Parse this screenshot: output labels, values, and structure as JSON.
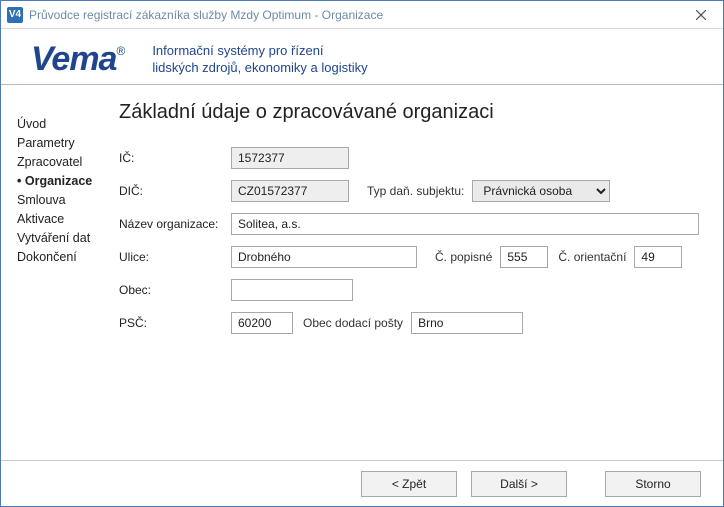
{
  "window": {
    "title": "Průvodce registrací zákazníka služby Mzdy Optimum - Organizace",
    "app_icon_text": "V4"
  },
  "header": {
    "logo_text": "Vema",
    "logo_reg": "®",
    "tagline_line1": "Informační systémy pro řízení",
    "tagline_line2": "lidských zdrojů, ekonomiky a logistiky"
  },
  "sidebar": {
    "steps": [
      {
        "label": "Úvod",
        "current": false
      },
      {
        "label": "Parametry",
        "current": false
      },
      {
        "label": "Zpracovatel",
        "current": false
      },
      {
        "label": "Organizace",
        "current": true
      },
      {
        "label": "Smlouva",
        "current": false
      },
      {
        "label": "Aktivace",
        "current": false
      },
      {
        "label": "Vytváření dat",
        "current": false
      },
      {
        "label": "Dokončení",
        "current": false
      }
    ]
  },
  "main": {
    "heading": "Základní údaje o zpracovávané organizaci",
    "labels": {
      "ic": "IČ:",
      "dic": "DIČ:",
      "subject_type": "Typ daň. subjektu:",
      "org_name": "Název organizace:",
      "street": "Ulice:",
      "house_no": "Č. popisné",
      "orient_no": "Č. orientační",
      "city": "Obec:",
      "psc": "PSČ:",
      "post_city": "Obec dodací pošty"
    },
    "values": {
      "ic": "1572377",
      "dic": "CZ01572377",
      "subject_type_selected": "Právnická osoba",
      "org_name": "Solitea, a.s.",
      "street": "Drobného",
      "house_no": "555",
      "orient_no": "49",
      "city": "",
      "psc": "60200",
      "post_city": "Brno"
    }
  },
  "footer": {
    "back": "< Zpět",
    "next": "Další >",
    "cancel": "Storno"
  }
}
